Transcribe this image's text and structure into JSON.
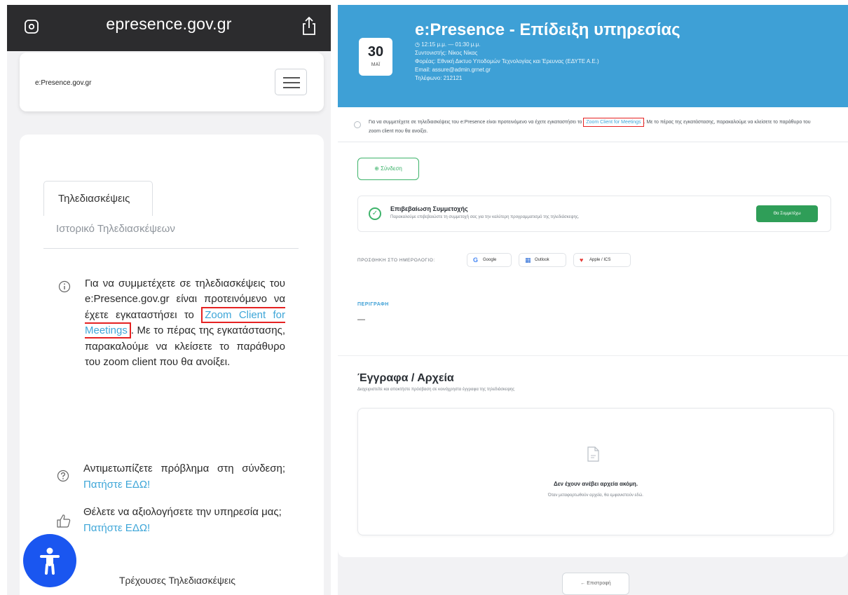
{
  "left_phone": {
    "url_domain": "epresence.gov.gr",
    "logo_text": "e:Presence.gov.gr",
    "tabs": {
      "active": "Τηλεδιασκέψεις",
      "inactive": "Ιστορικό Τηλεδιασκέψεων"
    },
    "info": {
      "before_link": "Για να συμμετέχετε σε τηλεδιασκέψεις του e:Presence.gov.gr είναι προτεινόμενο να έχετε εγκαταστήσει το",
      "link": "Zoom Client for Meetings",
      "after_link": ". Με το πέρας της εγκατάστασης, παρακαλούμε να κλείσετε το παράθυρο του zoom client που θα ανοίξει."
    },
    "help": {
      "text": "Αντιμετωπίζετε πρόβλημα στη σύνδεση;",
      "link": "Πατήστε ΕΔΩ!"
    },
    "rate": {
      "text": "Θέλετε να αξιολογήσετε την υπηρεσία μας;",
      "link": "Πατήστε ΕΔΩ!"
    },
    "current_conferences": "Τρέχουσες Τηλεδιασκέψεις"
  },
  "right_screen": {
    "date": {
      "day": "30",
      "month": "ΜΑΪ"
    },
    "title": "e:Presence - Επίδειξη υπηρεσίας",
    "meta_lines": [
      "◷ 12:15 μ.μ. — 01:30 μ.μ.",
      "Συντονιστής: Νίκος Νίκας",
      "Φορέας: Εθνική Δικτυο Υποδομών Τεχνολογίας και Έρευνας (ΕΔΥΤΕ Α.Ε.)",
      "Email: assure@admin.grnet.gr",
      "Τηλέφωνο: 212121"
    ],
    "notice": {
      "before_link": "Για να συμμετέχετε σε τηλεδιασκέψεις του e:Presence είναι προτεινόμενο να έχετε εγκαταστήσει το",
      "link": "Zoom Client for Meetings",
      "after_link": ". Με το πέρας της εγκατάστασης, παρακαλούμε να κλείσετε το παράθυρο του zoom client που θα ανοίξει."
    },
    "connect_button": "⊕ Σύνδεση",
    "confirm": {
      "title": "Επιβεβαίωση Συμμετοχής",
      "subtitle": "Παρακαλούμε επιβεβαιώστε τη συμμετοχή σας για την καλύτερη προγραμματισμό της τηλεδιάσκεψης.",
      "button": "Θα Συμμετέχω"
    },
    "calendar": {
      "label": "ΠΡΟΣΘΗΚΗ ΣΤΟ ΗΜΕΡΟΛΟΓΙΟ:",
      "google": "Google",
      "outlook": "Outlook",
      "apple": "Apple / ICS"
    },
    "description": {
      "label": "ΠΕΡΙΓΡΑΦΗ",
      "value": "—"
    },
    "documents": {
      "title": "Έγγραφα / Αρχεία",
      "subtitle": "Διαχειριστείτε και αποκτήστε πρόσβαση σε κοινόχρηστα έγγραφα της τηλεδιάσκεψης",
      "empty_title": "Δεν έχουν ανέβει αρχεία ακόμη.",
      "empty_sub": "Όταν μεταφορτωθούν αρχεία, θα εμφανιστούν εδώ."
    },
    "back_button": "← Επιστροφή"
  },
  "colors": {
    "accent": "#3ea0d6",
    "link": "#3ea6d8",
    "highlight_box": "#e52222",
    "success": "#2f9e58",
    "fab": "#1a56f0"
  }
}
